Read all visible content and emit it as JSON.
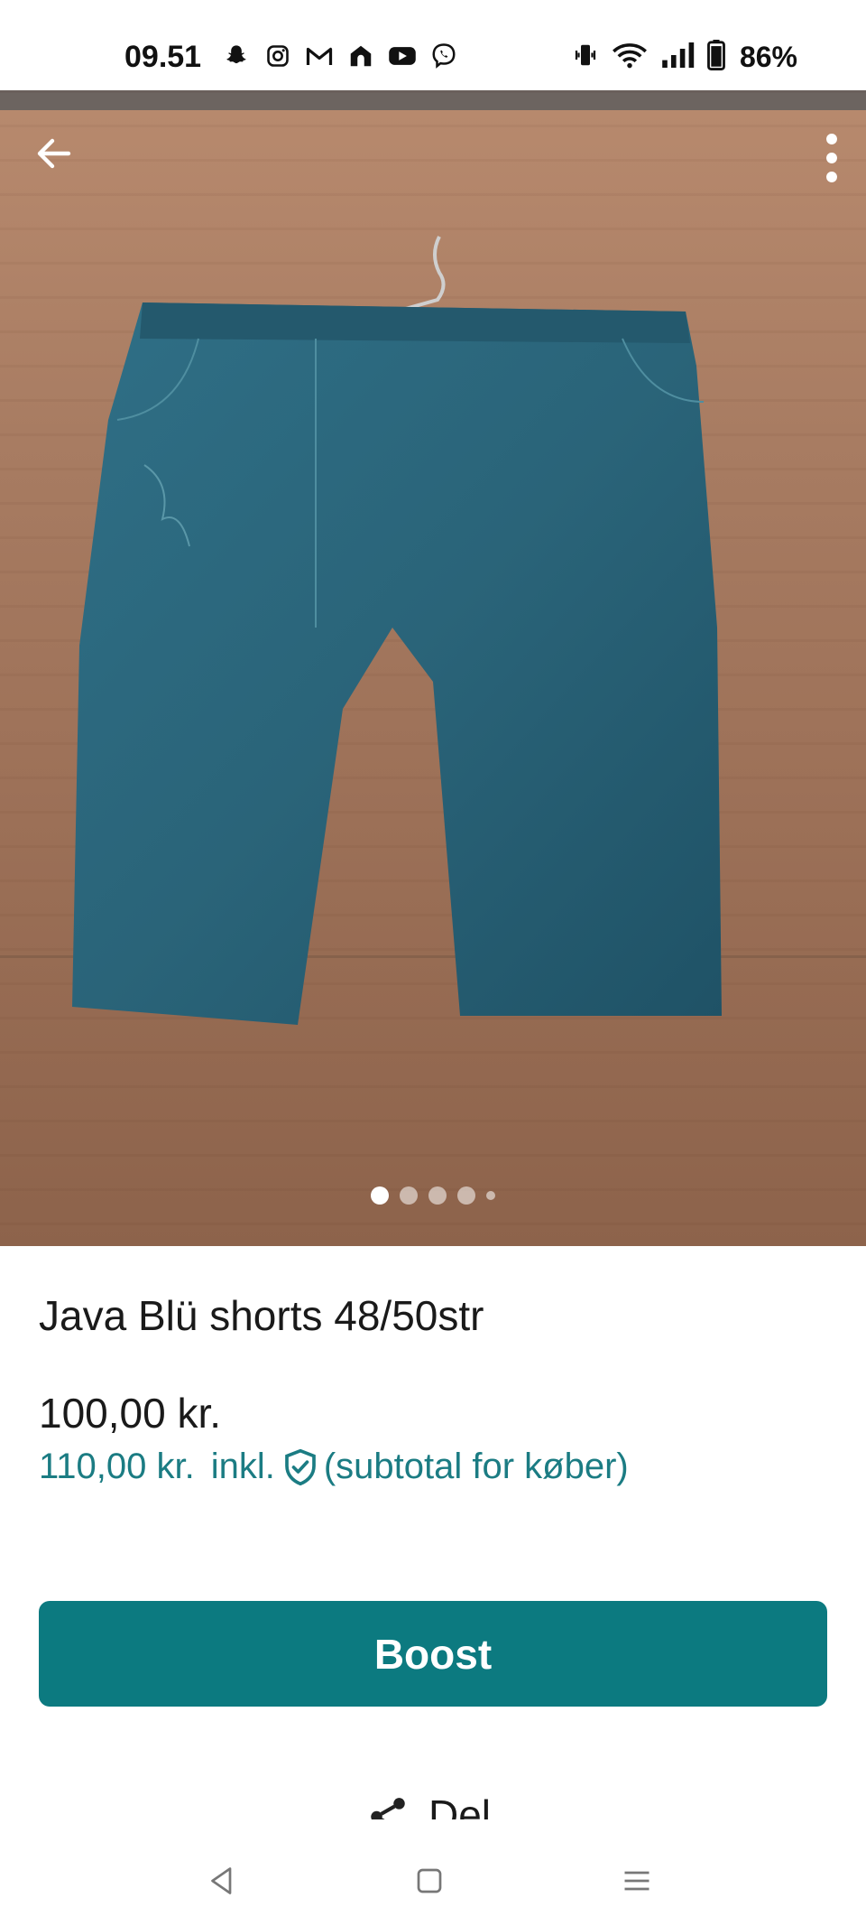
{
  "status_bar": {
    "time": "09.51",
    "battery": "86%",
    "app_icons": [
      "snapchat-icon",
      "instagram-icon",
      "gmail-icon",
      "home-app-icon",
      "youtube-icon",
      "viber-icon"
    ],
    "system_icons": [
      "vibrate-icon",
      "wifi-icon",
      "signal-icon",
      "battery-icon"
    ]
  },
  "listing": {
    "title": "Java Blü shorts 48/50str",
    "price": "100,00 kr.",
    "buyer_total": "110,00 kr.",
    "incl_label": "inkl.",
    "subtotal_note": "(subtotal for køber)",
    "photo_count": 5,
    "active_photo": 1
  },
  "actions": {
    "boost_label": "Boost",
    "share_label": "Del"
  },
  "colors": {
    "accent": "#0c7a80",
    "accent_text": "#1b7c83"
  }
}
